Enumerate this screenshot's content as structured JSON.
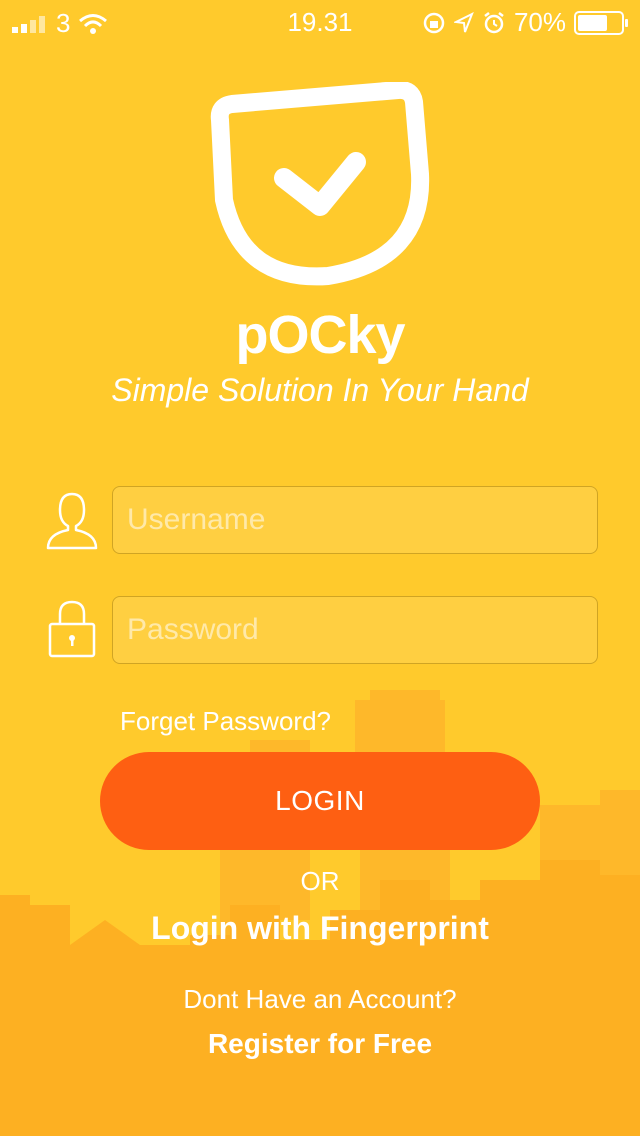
{
  "status_bar": {
    "carrier": "3",
    "time": "19.31",
    "battery": "70%",
    "battery_level": 0.7
  },
  "app": {
    "name": "pOCky",
    "tagline": "Simple Solution In Your Hand"
  },
  "login_form": {
    "username_placeholder": "Username",
    "password_placeholder": "Password",
    "forget_password": "Forget Password?",
    "login_button": "LOGIN",
    "or_text": "OR",
    "fingerprint_login": "Login with Fingerprint",
    "no_account_text": "Dont Have an Account?",
    "register_link": "Register for Free"
  },
  "colors": {
    "background": "#FFCA2C",
    "skyline": "#FDB022",
    "button": "#FE5F12",
    "text": "#FFFFFF"
  },
  "icons": [
    "signal-icon",
    "wifi-icon",
    "orientation-lock-icon",
    "location-icon",
    "alarm-icon",
    "battery-icon",
    "pocket-logo-icon",
    "user-icon",
    "lock-icon"
  ]
}
